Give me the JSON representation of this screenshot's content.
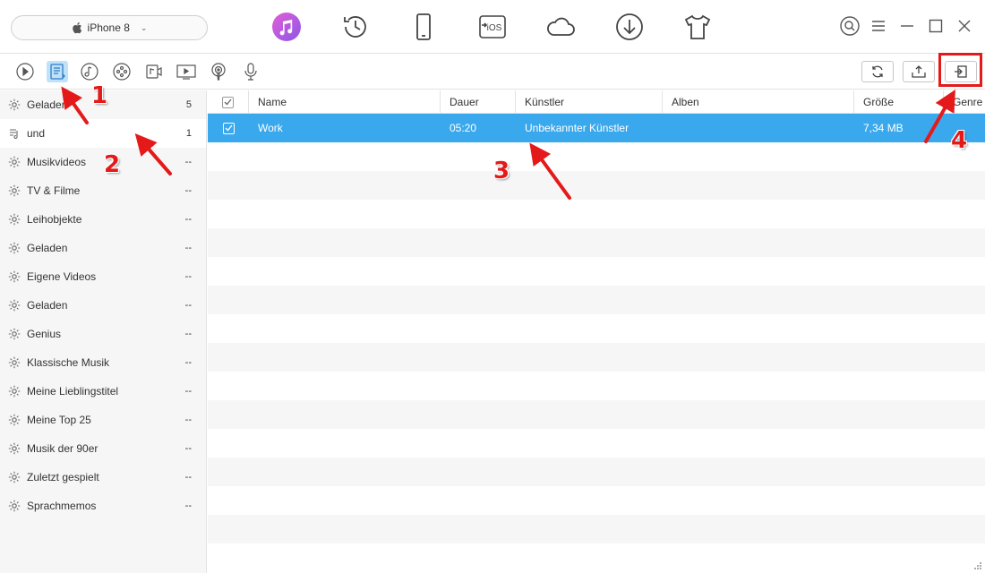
{
  "device": {
    "name": "iPhone 8",
    "icon": "apple-icon"
  },
  "main_nav": [
    {
      "name": "itunes-library-icon",
      "active": true,
      "color": "#b35ee0"
    },
    {
      "name": "backup-history-icon"
    },
    {
      "name": "device-manager-icon"
    },
    {
      "name": "ios-mover-icon",
      "label": "iOS"
    },
    {
      "name": "icloud-icon"
    },
    {
      "name": "download-icon"
    },
    {
      "name": "shirt-icon"
    }
  ],
  "window_controls": [
    "search-icon",
    "menu-icon",
    "minimize-icon",
    "maximize-icon",
    "close-icon"
  ],
  "categories": [
    {
      "name": "play-icon"
    },
    {
      "name": "playlist-icon",
      "active": true
    },
    {
      "name": "music-icon"
    },
    {
      "name": "ringtone-icon"
    },
    {
      "name": "video-icon"
    },
    {
      "name": "tv-icon"
    },
    {
      "name": "podcast-icon"
    },
    {
      "name": "voice-memo-icon"
    }
  ],
  "toolbar": {
    "refresh": "refresh-icon",
    "import": "import-to-device-icon",
    "export": "export-to-itunes-icon"
  },
  "sidebar": {
    "items": [
      {
        "label": "Geladen",
        "count": "5",
        "icon": "gear-icon"
      },
      {
        "label": "und",
        "count": "1",
        "icon": "playlist-note-icon",
        "selected": true
      },
      {
        "label": "Musikvideos",
        "count": "--",
        "icon": "gear-icon"
      },
      {
        "label": "TV & Filme",
        "count": "--",
        "icon": "gear-icon"
      },
      {
        "label": "Leihobjekte",
        "count": "--",
        "icon": "gear-icon"
      },
      {
        "label": "Geladen",
        "count": "--",
        "icon": "gear-icon"
      },
      {
        "label": "Eigene Videos",
        "count": "--",
        "icon": "gear-icon"
      },
      {
        "label": "Geladen",
        "count": "--",
        "icon": "gear-icon"
      },
      {
        "label": "Genius",
        "count": "--",
        "icon": "gear-icon"
      },
      {
        "label": "Klassische Musik",
        "count": "--",
        "icon": "gear-icon"
      },
      {
        "label": "Meine Lieblingstitel",
        "count": "--",
        "icon": "gear-icon"
      },
      {
        "label": "Meine Top 25",
        "count": "--",
        "icon": "gear-icon"
      },
      {
        "label": "Musik der 90er",
        "count": "--",
        "icon": "gear-icon"
      },
      {
        "label": "Zuletzt gespielt",
        "count": "--",
        "icon": "gear-icon"
      },
      {
        "label": "Sprachmemos",
        "count": "--",
        "icon": "gear-icon"
      }
    ]
  },
  "table": {
    "columns": [
      "Name",
      "Dauer",
      "Künstler",
      "Alben",
      "Größe",
      "Genre"
    ],
    "rows": [
      {
        "name": "Work",
        "duration": "05:20",
        "artist": "Unbekannter Künstler",
        "album": "",
        "size": "7,34 MB",
        "genre": "",
        "checked": true,
        "selected": true
      }
    ]
  },
  "annotations": {
    "n1": "1",
    "n2": "2",
    "n3": "3",
    "n4": "4",
    "color": "#e41a1a"
  },
  "colors": {
    "selection": "#3aa8ec",
    "active_category": "#bfe1fa",
    "zebra": "#f6f6f6"
  }
}
